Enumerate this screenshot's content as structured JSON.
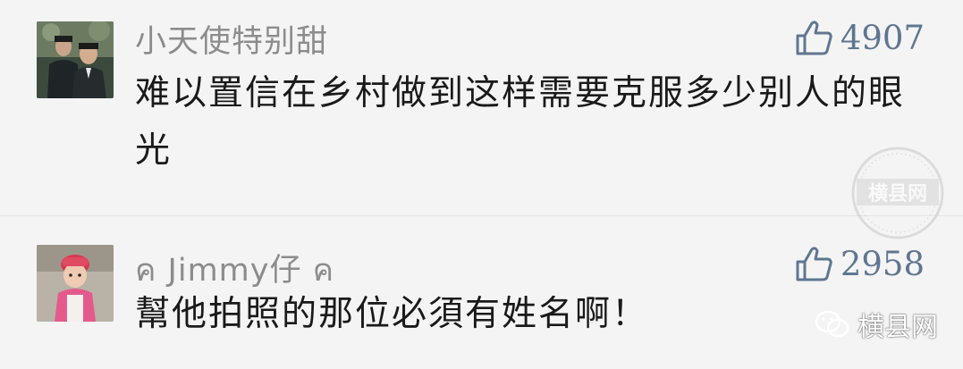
{
  "comments": [
    {
      "nickname": "小天使特别甜",
      "likes": "4907",
      "text": "难以置信在乡村做到这样需要克服多少别人的眼光"
    },
    {
      "nickname": "ค Jimmy仔 ค",
      "likes": "2958",
      "text": "幫他拍照的那位必須有姓名啊！"
    }
  ],
  "watermark": {
    "seal_text": "横县网",
    "brand_text": "横县网"
  },
  "colors": {
    "background": "#f4f4f4",
    "nickname": "#8c8c8c",
    "likes": "#5f7691",
    "content": "#1a1a1a"
  },
  "icons": {
    "like": "thumbs-up-icon",
    "brand": "wechat-icon"
  }
}
